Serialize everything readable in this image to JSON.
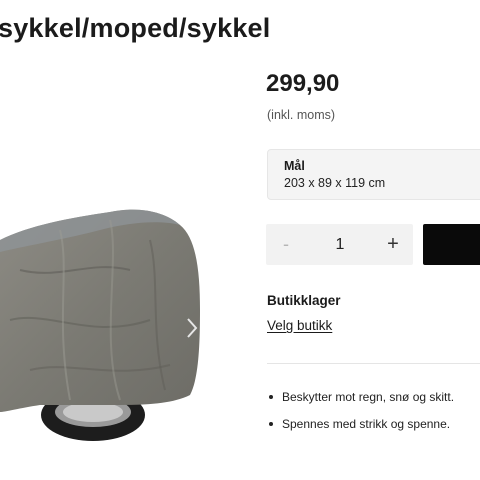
{
  "product": {
    "title": "sykkel/moped/sykkel",
    "price": "299,90",
    "vat_note": "(inkl. moms)",
    "spec": {
      "label": "Mål",
      "value": "203 x 89 x 119 cm"
    },
    "quantity": {
      "minus": "-",
      "value": "1",
      "plus": "+"
    },
    "store": {
      "heading": "Butikklager",
      "link": "Velg butikk"
    },
    "features": [
      "Beskytter mot regn, snø og skitt.",
      "Spennes med strikk og spenne."
    ]
  },
  "colors": {
    "buy_button": "#0a0a0a",
    "qty_bg": "#f2f2f2",
    "spec_bg": "#f4f4f4"
  },
  "icons": {
    "gallery_next": "chevron-right-icon"
  }
}
